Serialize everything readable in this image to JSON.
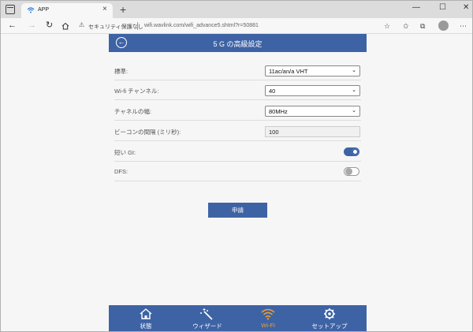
{
  "browser": {
    "tab_title": "APP",
    "tab_close": "×",
    "new_tab": "+",
    "window_controls": {
      "minimize": "—",
      "maximize": "☐",
      "close": "✕"
    },
    "address": {
      "security_text": "セキュリティ保護なし",
      "url": "wifi.wavlink.com/wifi_advance5.shtml?r=50881"
    }
  },
  "page": {
    "title": "5 G の高級設定",
    "rows": [
      {
        "label": "標準:",
        "type": "select",
        "value": "11ac/an/a VHT"
      },
      {
        "label": "Wi-fi チャンネル:",
        "type": "select",
        "value": "40"
      },
      {
        "label": "チャネルの幅:",
        "type": "select",
        "value": "80MHz"
      },
      {
        "label": "ビーコンの間隔 (ミリ秒):",
        "type": "text",
        "value": "100"
      },
      {
        "label": "短い GI:",
        "type": "toggle",
        "on": true
      },
      {
        "label": "DFS:",
        "type": "toggle",
        "on": false
      }
    ],
    "apply_label": "申請"
  },
  "bottom_nav": {
    "items": [
      {
        "label": "状態",
        "icon": "home-icon",
        "active": false
      },
      {
        "label": "ウィザード",
        "icon": "magic-wand-icon",
        "active": false
      },
      {
        "label": "Wi-Fi",
        "icon": "wifi-icon",
        "active": true
      },
      {
        "label": "セットアップ",
        "icon": "gear-icon",
        "active": false
      }
    ]
  },
  "colors": {
    "primary": "#3e63a5",
    "active_nav": "#f0a030",
    "background": "#f6f6f6"
  }
}
